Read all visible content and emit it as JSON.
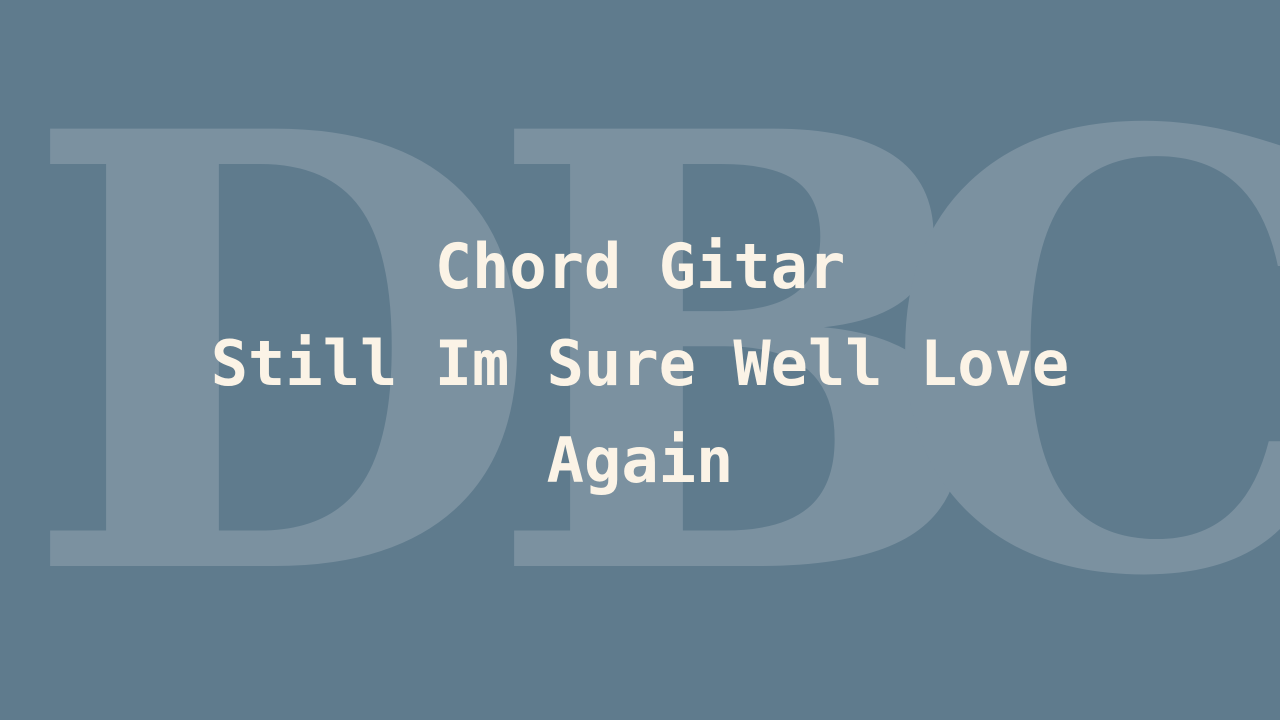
{
  "background_color": "#5f7b8d",
  "watermark": {
    "letters": [
      "D",
      "B",
      "C"
    ],
    "color": "#7b91a0"
  },
  "title": {
    "line1": "Chord Gitar",
    "line2": "Still Im Sure Well Love",
    "line3": "Again",
    "color": "#fbf3e6"
  }
}
